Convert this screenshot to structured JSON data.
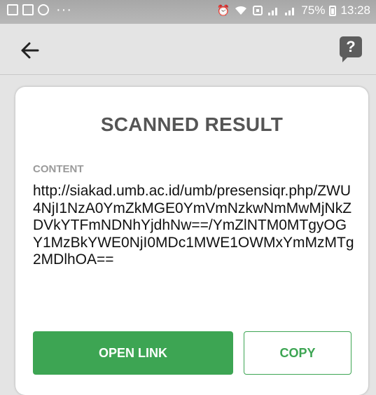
{
  "status_bar": {
    "icons_left": [
      "gallery-icon",
      "store-bag-icon",
      "settings-badge-icon"
    ],
    "more_indicator": "···",
    "icons_right": [
      "alarm-icon",
      "wifi-icon",
      "nfc-icon",
      "signal-icon",
      "signal-icon"
    ],
    "battery": "75%",
    "time": "13:28"
  },
  "app_bar": {
    "back_icon": "arrow-left-icon",
    "help_icon": "help-question-icon",
    "help_glyph": "?"
  },
  "card": {
    "title": "SCANNED RESULT",
    "content_label": "CONTENT",
    "content_value": "http://siakad.umb.ac.id/umb/presensiqr.php/ZWU4NjI1NzA0YmZkMGE0YmVmNzkwNmMwMjNkZDVkYTFmNDNhYjdhNw==/YmZlNTM0MTgyOGY1MzBkYWE0NjI0MDc1MWE1OWMxYmMzMTg2MDlhOA==",
    "open_link_label": "OPEN LINK",
    "copy_label": "COPY"
  },
  "colors": {
    "accent_green": "#3da553",
    "status_bar": "#b0b0b0",
    "app_bar": "#e4e4e4"
  }
}
